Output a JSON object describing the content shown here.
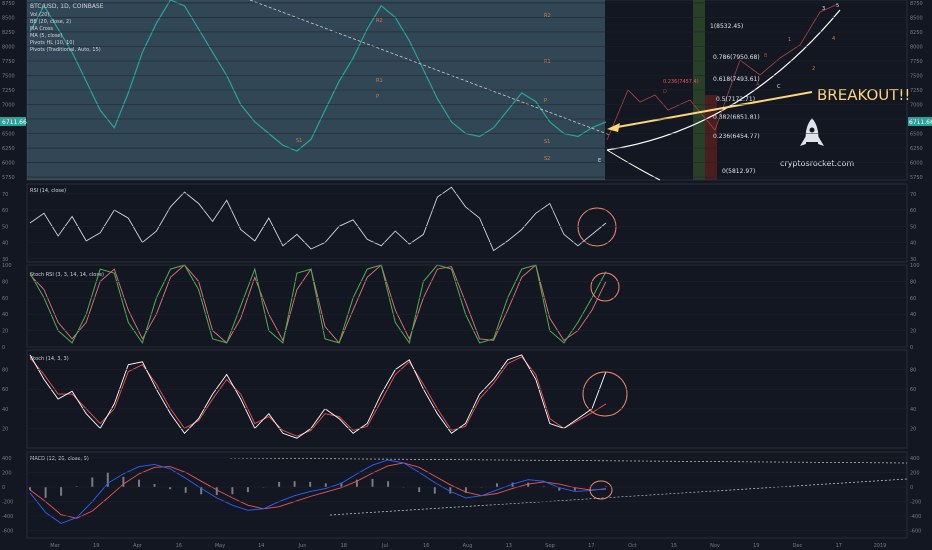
{
  "header": {
    "symbol": "BTC/USD, 1D, COINBASE",
    "legend": [
      "Vol (20)",
      "BB (20, close, 2)",
      "MA Cross",
      "MA (5, close)",
      "Pivots HL (10, 10)",
      "Pivots (Traditional, Auto, 15)"
    ],
    "price_badge": "6711.66"
  },
  "annotations": {
    "breakout": "BREAKOUT!!",
    "site": "cryptosrocket.com",
    "fib_levels": [
      "1(8532.45)",
      "0.786(7950.68)",
      "0.618(7493.61)",
      "0.5(7172.71)",
      "0.382(6851.81)",
      "0.236(6454.77)",
      "0(5812.97)"
    ],
    "fib_side": "0.236(7457.4)",
    "waves": [
      "1",
      "2",
      "3",
      "4",
      "5",
      "A",
      "B",
      "C",
      "D",
      "E"
    ],
    "pivots": [
      "R2",
      "R1",
      "P",
      "S1",
      "R2",
      "R1",
      "P",
      "S1",
      "S2"
    ]
  },
  "colors": {
    "background": "#131722",
    "panel_border": "#2a2e39",
    "price_line": "#26a69a",
    "band_fill": "#5c7d8a",
    "rsi": "#d1d4dc",
    "stoch_k": "#4caf50",
    "stoch_d": "#e57373",
    "macd": "#2962ff",
    "signal": "#ef5350",
    "circle": "#f48a6a",
    "breakout_arrow": "#ffd57a"
  },
  "chart_data": [
    {
      "type": "line",
      "title": "BTC/USD, 1D, COINBASE",
      "y_ticks": [
        5750,
        6000,
        6250,
        6500,
        6750,
        7000,
        7250,
        7500,
        7750,
        8000,
        8250,
        8500,
        8750
      ],
      "ylim": [
        5700,
        8800
      ],
      "x_ticks": [
        "Mar",
        "19",
        "Apr",
        "16",
        "May",
        "14",
        "Jun",
        "18",
        "Jul",
        "16",
        "Aug",
        "13",
        "Sep",
        "17",
        "Oct",
        "15",
        "Nov",
        "19",
        "Dec",
        "17",
        "2019"
      ],
      "series": [
        {
          "name": "BTC/USD",
          "values": [
            8250,
            8700,
            8300,
            7900,
            7400,
            6900,
            6600,
            7200,
            7900,
            8400,
            8800,
            8700,
            8300,
            7900,
            7500,
            7000,
            6700,
            6500,
            6300,
            6200,
            6400,
            6900,
            7400,
            7800,
            8300,
            8700,
            8500,
            8100,
            7600,
            7100,
            6700,
            6500,
            6450,
            6600,
            6900,
            7200,
            7050,
            6700,
            6500,
            6450,
            6600,
            6700
          ]
        }
      ]
    },
    {
      "type": "line",
      "title": "RSI (14, close)",
      "y_ticks": [
        30,
        40,
        50,
        60,
        70
      ],
      "ylim": [
        28,
        76
      ],
      "series": [
        {
          "name": "RSI",
          "values": [
            52,
            58,
            44,
            56,
            41,
            46,
            60,
            55,
            40,
            47,
            62,
            71,
            64,
            53,
            66,
            48,
            41,
            55,
            38,
            45,
            36,
            40,
            50,
            54,
            42,
            38,
            47,
            39,
            45,
            68,
            74,
            62,
            55,
            35,
            41,
            48,
            58,
            64,
            45,
            38,
            45,
            52
          ]
        }
      ]
    },
    {
      "type": "line",
      "title": "Stoch RSI (3, 3, 14, 14, close)",
      "y_ticks": [
        0,
        20,
        40,
        60,
        80,
        100
      ],
      "ylim": [
        0,
        100
      ],
      "series": [
        {
          "name": "K",
          "values": [
            90,
            60,
            20,
            5,
            40,
            95,
            90,
            30,
            5,
            60,
            95,
            100,
            70,
            10,
            5,
            50,
            95,
            20,
            5,
            90,
            95,
            10,
            5,
            60,
            95,
            100,
            30,
            5,
            80,
            100,
            95,
            40,
            5,
            10,
            60,
            95,
            100,
            20,
            5,
            30,
            60,
            92
          ]
        },
        {
          "name": "D",
          "values": [
            88,
            70,
            30,
            10,
            30,
            80,
            95,
            45,
            10,
            40,
            85,
            100,
            80,
            20,
            5,
            35,
            85,
            40,
            8,
            70,
            95,
            25,
            5,
            45,
            85,
            100,
            45,
            10,
            60,
            95,
            98,
            55,
            10,
            8,
            45,
            85,
            100,
            35,
            8,
            20,
            45,
            80
          ]
        }
      ]
    },
    {
      "type": "line",
      "title": "Stoch (14, 3, 3)",
      "y_ticks": [
        20,
        40,
        60,
        80
      ],
      "ylim": [
        0,
        100
      ],
      "series": [
        {
          "name": "K",
          "values": [
            95,
            70,
            50,
            58,
            35,
            20,
            45,
            85,
            88,
            60,
            35,
            15,
            30,
            55,
            75,
            50,
            20,
            35,
            15,
            10,
            20,
            40,
            30,
            15,
            25,
            55,
            80,
            90,
            60,
            35,
            15,
            25,
            55,
            70,
            90,
            95,
            70,
            25,
            20,
            30,
            40,
            78
          ]
        },
        {
          "name": "D",
          "values": [
            92,
            75,
            55,
            55,
            40,
            25,
            40,
            78,
            85,
            65,
            40,
            20,
            28,
            50,
            70,
            55,
            25,
            32,
            18,
            12,
            18,
            35,
            32,
            18,
            22,
            48,
            75,
            88,
            65,
            40,
            18,
            22,
            50,
            66,
            86,
            93,
            75,
            30,
            20,
            28,
            36,
            45
          ]
        }
      ]
    },
    {
      "type": "line",
      "title": "MACD (12, 26, close, 9)",
      "y_ticks": [
        -600,
        -400,
        -200,
        0,
        200,
        400
      ],
      "ylim": [
        -700,
        480
      ],
      "series": [
        {
          "name": "MACD",
          "values": [
            -80,
            -350,
            -500,
            -420,
            -200,
            50,
            180,
            280,
            310,
            250,
            120,
            -20,
            -150,
            -250,
            -320,
            -300,
            -200,
            -120,
            -60,
            -20,
            50,
            180,
            300,
            370,
            330,
            200,
            60,
            -60,
            -150,
            -120,
            -40,
            40,
            100,
            80,
            -10,
            -60,
            -50,
            -20
          ]
        },
        {
          "name": "Signal",
          "values": [
            -40,
            -200,
            -380,
            -430,
            -330,
            -150,
            40,
            180,
            270,
            280,
            200,
            80,
            -40,
            -150,
            -250,
            -300,
            -270,
            -200,
            -130,
            -70,
            -10,
            80,
            190,
            290,
            330,
            270,
            150,
            30,
            -70,
            -120,
            -90,
            -20,
            40,
            70,
            40,
            -10,
            -40,
            -30
          ]
        }
      ]
    }
  ]
}
